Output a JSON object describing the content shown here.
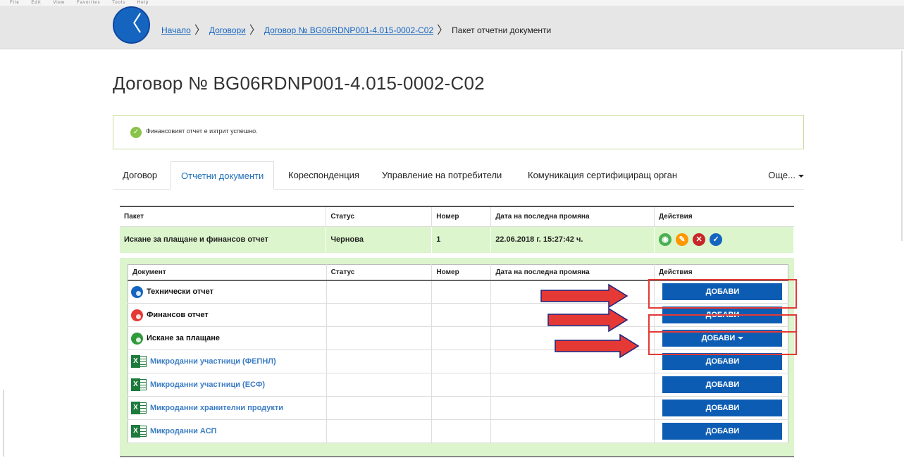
{
  "menubar": [
    "File",
    "Edit",
    "View",
    "Favorites",
    "Tools",
    "Help"
  ],
  "breadcrumb": {
    "back_icon": "chevron-left-icon",
    "items": [
      "Начало",
      "Договори",
      "Договор № BG06RDNP001-4.015-0002-C02"
    ],
    "current": "Пакет отчетни документи"
  },
  "page_title": "Договор № BG06RDNP001-4.015-0002-C02",
  "alert": {
    "icon": "check-circle-icon",
    "message": "Финансовият отчет е изтрит успешно."
  },
  "tabs": [
    "Договор",
    "Отчетни документи",
    "Кореспонденция",
    "Управление на потребители",
    "Комуникация сертифициращ орган"
  ],
  "active_tab": "Отчетни документи",
  "tab_more": "Още...",
  "package_table": {
    "headers": [
      "Пакет",
      "Статус",
      "Номер",
      "Дата на последна промяна",
      "Действия"
    ],
    "row": {
      "package": "Искане за плащане и финансов отчет",
      "status": "Чернова",
      "number": "1",
      "date": "22.06.2018 г. 15:27:42 ч.",
      "actions": [
        "eye-icon",
        "pencil-icon",
        "close-icon",
        "check-icon"
      ]
    }
  },
  "documents_table": {
    "headers": [
      "Документ",
      "Статус",
      "Номер",
      "Дата на последна промяна",
      "Действия"
    ],
    "rows": [
      {
        "name": "Технически отчет",
        "icon": "technical-report-icon",
        "button": "ДОБАВИ"
      },
      {
        "name": "Финансов отчет",
        "icon": "financial-report-icon",
        "button": "ДОБАВИ"
      },
      {
        "name": "Искане за плащане",
        "icon": "payment-request-icon",
        "button": "ДОБАВИ"
      },
      {
        "name": "Микроданни участници (ФЕПНЛ)",
        "icon": "excel-icon",
        "button": "ДОБАВИ"
      },
      {
        "name": "Микроданни участници (ЕСФ)",
        "icon": "excel-icon",
        "button": "ДОБАВИ"
      },
      {
        "name": "Микроданни хранителни продукти",
        "icon": "excel-icon",
        "button": "ДОБАВИ"
      },
      {
        "name": "Микроданни АСП",
        "icon": "excel-icon",
        "button": "ДОБАВИ"
      }
    ]
  },
  "colors": {
    "primary": "#0d5cb3",
    "success_bg": "#dcf5cc",
    "annotation": "#e53935"
  }
}
